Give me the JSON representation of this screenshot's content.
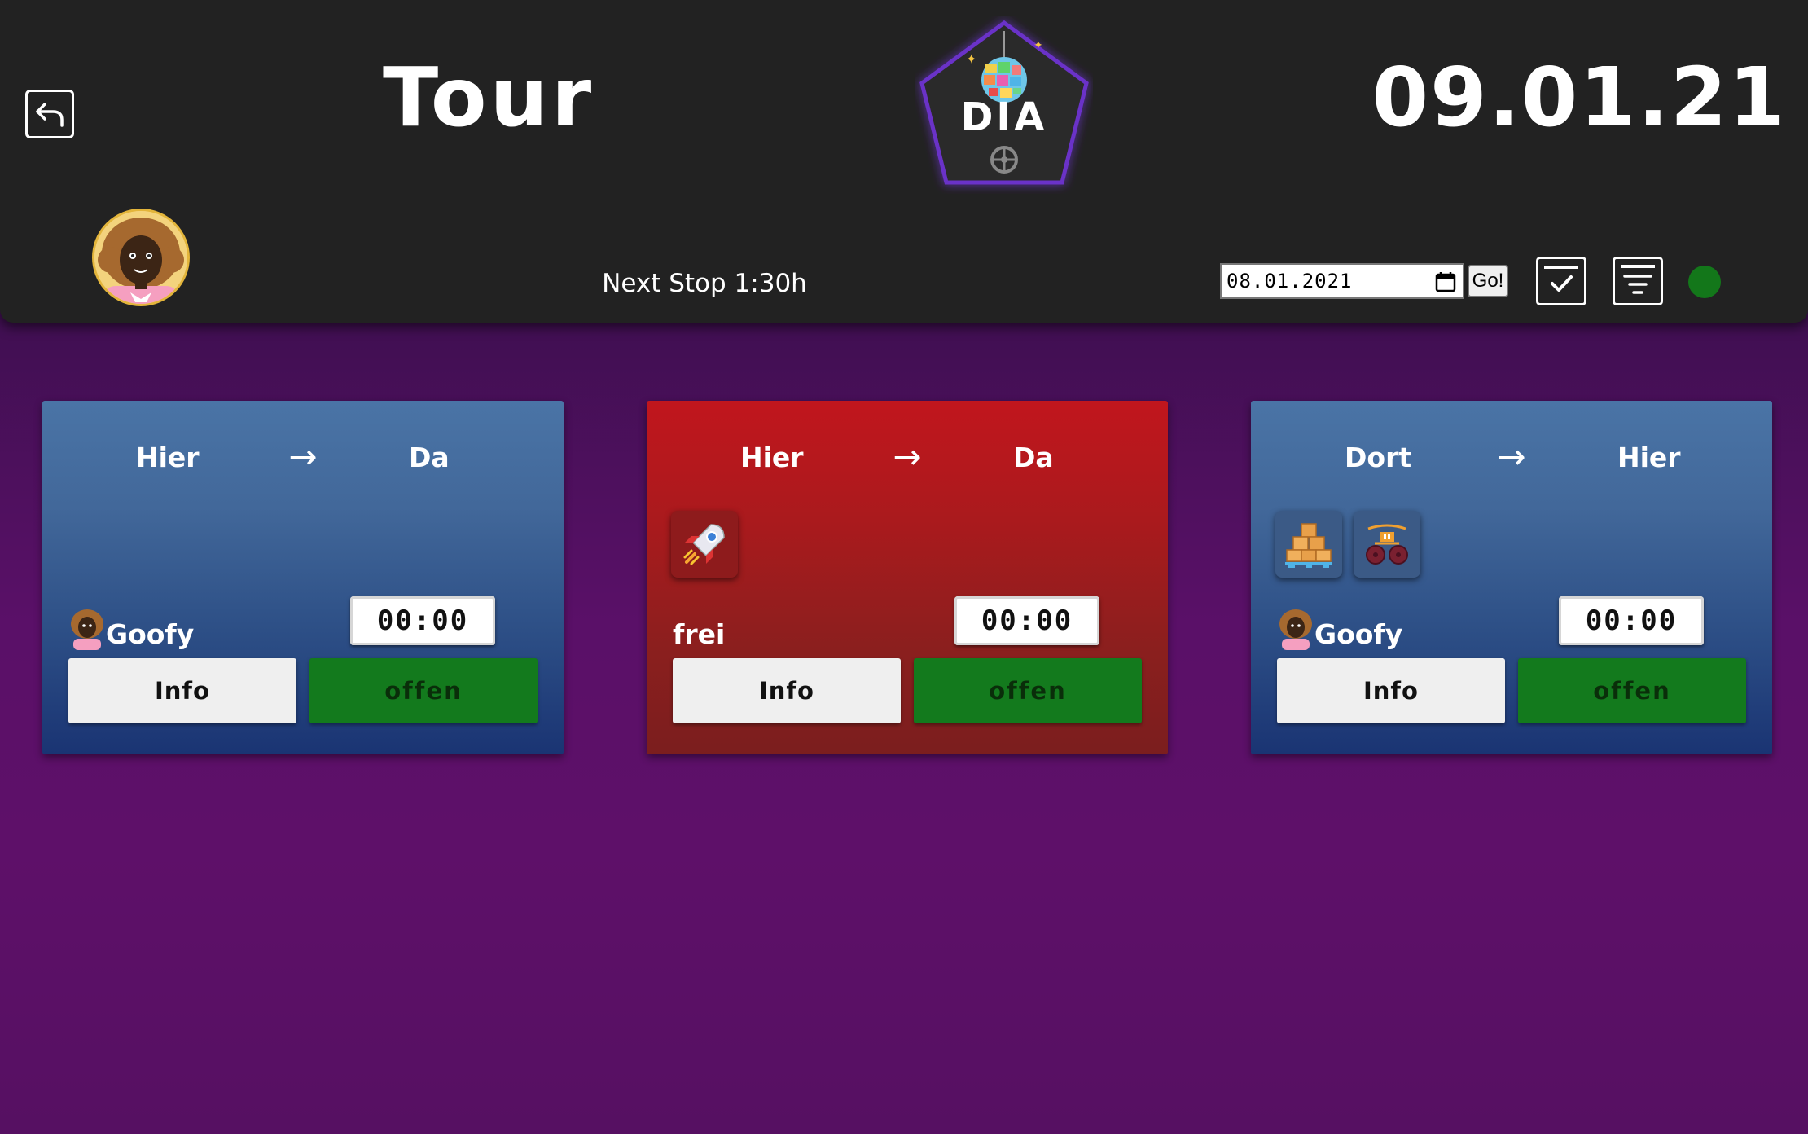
{
  "header": {
    "title": "Tour",
    "date_display": "09.01.21",
    "logo_text": "DIA",
    "next_stop": "Next Stop 1:30h",
    "date_input_value": "08.01.2021",
    "go_label": "Go!",
    "status_color": "#13771a"
  },
  "icons": {
    "back": "undo-arrow-icon",
    "calendar": "calendar-icon",
    "check": "check-square-icon",
    "filter": "filter-list-icon"
  },
  "cards": [
    {
      "color": "blue",
      "from": "Hier",
      "arrow": "→",
      "to": "Da",
      "driver": "Goofy",
      "timer": "00:00",
      "info_label": "Info",
      "status_label": "offen"
    },
    {
      "color": "red",
      "from": "Hier",
      "arrow": "→",
      "to": "Da",
      "driver": "frei",
      "timer": "00:00",
      "info_label": "Info",
      "status_label": "offen",
      "tags": [
        "rocket-icon"
      ]
    },
    {
      "color": "blue",
      "from": "Dort",
      "arrow": "→",
      "to": "Hier",
      "driver": "Goofy",
      "timer": "00:00",
      "info_label": "Info",
      "status_label": "offen",
      "tags": [
        "boxes-icon",
        "cart-icon"
      ]
    }
  ]
}
